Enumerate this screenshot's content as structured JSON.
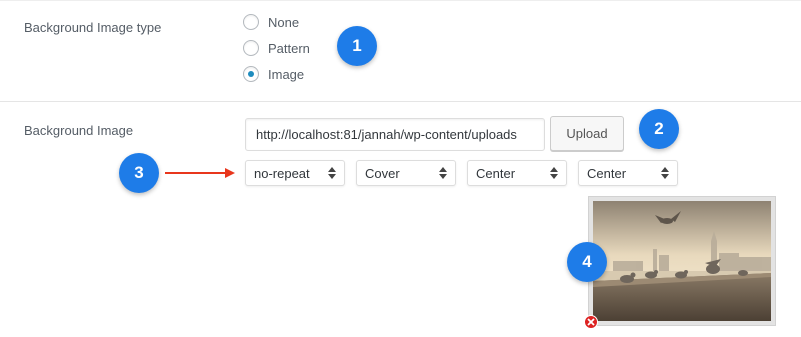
{
  "bg_type": {
    "label": "Background Image type",
    "options": [
      {
        "label": "None",
        "checked": false
      },
      {
        "label": "Pattern",
        "checked": false
      },
      {
        "label": "Image",
        "checked": true
      }
    ]
  },
  "bg_image": {
    "label": "Background Image",
    "url_value": "http://localhost:81/jannah/wp-content/uploads",
    "upload_label": "Upload",
    "selects": {
      "repeat": "no-repeat",
      "size": "Cover",
      "position_x": "Center",
      "position_y": "Center"
    }
  },
  "badges": [
    "1",
    "2",
    "3",
    "4"
  ],
  "colors": {
    "badge": "#1e7ce8",
    "arrow": "#e8361c",
    "radio_checked": "#1e8cbe",
    "remove": "#dd2222"
  },
  "icons": {
    "remove": "close-circle-icon",
    "select_arrow": "up-down-arrow-icon",
    "preview": "london-pigeons-photo"
  }
}
